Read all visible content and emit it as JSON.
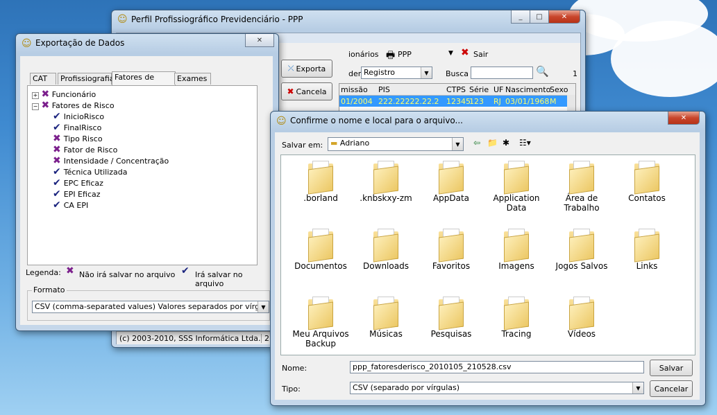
{
  "ppp_window": {
    "title": "Perfil Profissiográfico Previdenciário - PPP",
    "toolbar": {
      "funcionarios": "ionários",
      "ppp": "PPP",
      "sair": "Sair"
    },
    "ordem_label": "dem",
    "ordem_value": "Registro",
    "busca_label": "Busca",
    "page_num": "1",
    "grid_headers": [
      "missão",
      "PIS",
      "CTPS",
      "Série",
      "UF",
      "Nascimento",
      "Sexo"
    ],
    "grid_row": [
      "01/2004",
      "222.22222.22.2",
      "12345",
      "123",
      "RJ",
      "03/01/1968",
      "M"
    ],
    "status_text": "(c) 2003-2010, SSS Informática Ltda.",
    "status_num": "2"
  },
  "export_window": {
    "title": "Exportação de Dados",
    "tabs": [
      "CAT",
      "Profissiografia",
      "Fatores de Risco",
      "Exames"
    ],
    "selected_tab": "Fatores de Risco",
    "buttons": {
      "exporta": "Exporta",
      "cancela": "Cancela"
    },
    "tree": {
      "funcionario": "Funcionário",
      "fatores": "Fatores de Risco",
      "children": [
        {
          "label": "InicioRisco",
          "state": "check"
        },
        {
          "label": "FinalRisco",
          "state": "check"
        },
        {
          "label": "Tipo Risco",
          "state": "x"
        },
        {
          "label": "Fator de Risco",
          "state": "x"
        },
        {
          "label": "Intensidade / Concentração",
          "state": "x"
        },
        {
          "label": "Técnica Utilizada",
          "state": "check"
        },
        {
          "label": "EPC Eficaz",
          "state": "check"
        },
        {
          "label": "EPI Eficaz",
          "state": "check"
        },
        {
          "label": "CA EPI",
          "state": "check"
        }
      ]
    },
    "legend_label": "Legenda:",
    "legend_x": "Não irá salvar no arquivo",
    "legend_check": "Irá salvar no arquivo",
    "formato_label": "Formato",
    "formato_value": "CSV (comma-separated values) Valores separados por vírgula"
  },
  "save_dialog": {
    "title": "Confirme o nome e local  para o arquivo...",
    "salvar_em_label": "Salvar em:",
    "salvar_em_value": "Adriano",
    "folders": [
      {
        "label": ".borland"
      },
      {
        "label": ".knbskxy-zm"
      },
      {
        "label": "AppData"
      },
      {
        "label": "Application Data"
      },
      {
        "label": "Área de Trabalho"
      },
      {
        "label": "Contatos"
      },
      {
        "label": "Documentos"
      },
      {
        "label": "Downloads"
      },
      {
        "label": "Favoritos"
      },
      {
        "label": "Imagens"
      },
      {
        "label": "Jogos Salvos"
      },
      {
        "label": "Links"
      },
      {
        "label": "Meu Arquivos Backup"
      },
      {
        "label": "Músicas"
      },
      {
        "label": "Pesquisas"
      },
      {
        "label": "Tracing"
      },
      {
        "label": "Vídeos"
      }
    ],
    "nome_label": "Nome:",
    "nome_value": "ppp_fatoresderisco_2010105_210528.csv",
    "tipo_label": "Tipo:",
    "tipo_value": "CSV (separado por vírgulas)",
    "salvar_button": "Salvar",
    "cancelar_button": "Cancelar"
  },
  "colors": {
    "selection": "#3399ff",
    "grid_highlight_text": "#ffff66",
    "x_mark": "#7b1f8c",
    "check_mark": "#1a237e"
  }
}
